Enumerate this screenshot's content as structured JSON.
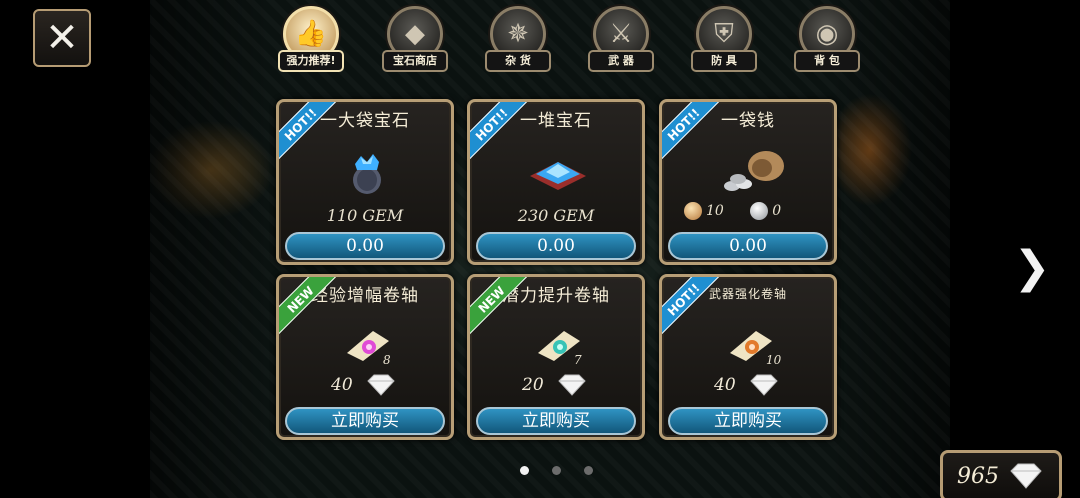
{
  "close": {
    "icon": "close-icon"
  },
  "tabs": [
    {
      "label": "强力推荐!",
      "icon": "thumbs-up-icon",
      "glyph": "👍",
      "active": true
    },
    {
      "label": "宝石商店",
      "icon": "gem-icon",
      "glyph": "◆",
      "active": false
    },
    {
      "label": "杂 货",
      "icon": "compass-icon",
      "glyph": "✵",
      "active": false
    },
    {
      "label": "武 器",
      "icon": "sword-icon",
      "glyph": "⚔",
      "active": false
    },
    {
      "label": "防 具",
      "icon": "shield-icon",
      "glyph": "⛨",
      "active": false
    },
    {
      "label": "背 包",
      "icon": "bag-icon",
      "glyph": "◉",
      "active": false
    }
  ],
  "cards": [
    {
      "title": "一大袋宝石",
      "badge": "HOT!!",
      "badge_type": "hot",
      "item_icon": "gem-jar-icon",
      "amount": "110 GEM",
      "button": "0.00"
    },
    {
      "title": "一堆宝石",
      "badge": "HOT!!",
      "badge_type": "hot",
      "item_icon": "gem-pile-icon",
      "amount": "230 GEM",
      "button": "0.00"
    },
    {
      "title": "一袋钱",
      "badge": "HOT!!",
      "badge_type": "hot",
      "item_icon": "money-bag-icon",
      "gold": "10",
      "silver": "0",
      "button": "0.00"
    },
    {
      "title": "经验增幅卷轴",
      "badge": "NEW",
      "badge_type": "new",
      "item_icon": "scroll-pink-icon",
      "qty": "8",
      "gem_price": "40",
      "button": "立即购买"
    },
    {
      "title": "潜力提升卷轴",
      "badge": "NEW",
      "badge_type": "new",
      "item_icon": "scroll-teal-icon",
      "qty": "7",
      "gem_price": "20",
      "button": "立即购买"
    },
    {
      "title": "武器强化卷轴",
      "badge": "HOT!!",
      "badge_type": "hot",
      "item_icon": "scroll-orange-icon",
      "qty": "10",
      "gem_price": "40",
      "button": "立即购买"
    }
  ],
  "pagination": {
    "pages": 3,
    "current": 1
  },
  "next": {
    "glyph": "❯"
  },
  "balance": {
    "value": "965",
    "icon": "diamond-icon"
  },
  "colors": {
    "hot": "#1f8fd1",
    "new": "#3aa23c",
    "button": "#1f78a6",
    "frame": "#b79e76"
  }
}
